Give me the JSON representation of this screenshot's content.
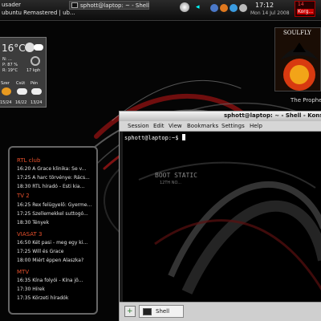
{
  "panel": {
    "left_text": "usader",
    "window_title": "ubuntu Remastered | ub...",
    "taskbar_item": "sphott@laptop: ~ - Shell",
    "clock_time": "17:12",
    "clock_date": "Mon 14 Jul 2008",
    "tray_label": "Korg...",
    "tray_number": "14",
    "icons": [
      "terminal-icon",
      "media-icon",
      "network-icon",
      "firefox-icon",
      "chat-icon",
      "volume-icon"
    ]
  },
  "weather": {
    "temperature": "16°C",
    "line1": "N: ...",
    "line2": "P: 87 %",
    "line3": "R: 19°C",
    "wind": "17 kph",
    "days": [
      "Szer",
      "Csüt",
      "Pén"
    ],
    "day_values": [
      "15/24",
      "16/22",
      "13/24"
    ]
  },
  "album": {
    "title": "SOULFLY",
    "caption": "The Prophe..."
  },
  "tv": {
    "channels": [
      {
        "name": "RTL club",
        "shows": [
          {
            "time": "16:20",
            "title": "A Grace klinika: Se v..."
          },
          {
            "time": "17:25",
            "title": "A harc törvénye: Rács..."
          },
          {
            "time": "18:30",
            "title": "RTL híradó - Esti kia..."
          }
        ]
      },
      {
        "name": "TV 2",
        "shows": [
          {
            "time": "16:25",
            "title": "Rex felügyelő: Gyerme..."
          },
          {
            "time": "17:25",
            "title": "Szellemekkel suttogó..."
          },
          {
            "time": "18:30",
            "title": "Tények"
          }
        ]
      },
      {
        "name": "VIASAT 3",
        "shows": [
          {
            "time": "16:50",
            "title": "Két pasi - meg egy ki..."
          },
          {
            "time": "17:25",
            "title": "Will és Grace"
          },
          {
            "time": "18:00",
            "title": "Miért éppen Alaszka?"
          }
        ]
      },
      {
        "name": "MTV",
        "shows": [
          {
            "time": "16:35",
            "title": "Kína folyói - Kína jö..."
          },
          {
            "time": "17:30",
            "title": "Hírek"
          },
          {
            "time": "17:35",
            "title": "Körzeti híradók"
          }
        ]
      }
    ]
  },
  "konsole": {
    "title": "sphott@laptop: ~ - Shell - Konsole",
    "menus": [
      "Session",
      "Edit",
      "View",
      "Bookmarks",
      "Settings",
      "Help"
    ],
    "prompt": "sphott@laptop:~$ ",
    "tab_label": "Shell"
  },
  "wallpaper": {
    "text1": "BOOT STATIC",
    "text2": "12TH NO..."
  },
  "colors": {
    "accent": "#e8502c",
    "panel": "#1a1a1a"
  }
}
